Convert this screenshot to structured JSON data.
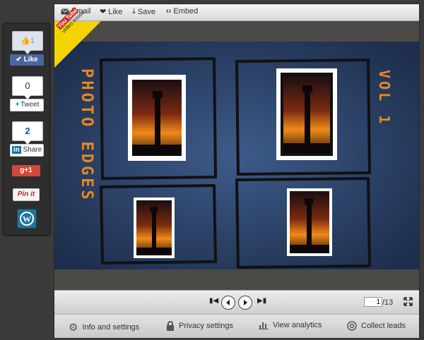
{
  "social": {
    "fb_count": "1",
    "fb_label": "Like",
    "tweet_count": "0",
    "tweet_label": "Tweet",
    "linkedin_count": "2",
    "linkedin_label": "Share",
    "gplus_label": "g+1",
    "pin_label": "Pin it"
  },
  "topbar": {
    "email_label": "Email",
    "like_label": "Like",
    "save_label": "Save",
    "embed_label": "Embed"
  },
  "badge": {
    "logo_text": "You Tube",
    "caption": "video inside."
  },
  "slide": {
    "title_left": "PHOTO EDGES",
    "title_right": "VOL 1"
  },
  "controls": {
    "page_value": "1",
    "page_total": "/13"
  },
  "bottombar": {
    "info_label": "Info and settings",
    "privacy_label": "Privacy settings",
    "analytics_label": "View analytics",
    "leads_label": "Collect leads"
  },
  "colors": {
    "accent_orange": "#e8891f",
    "slide_blue": "#3b5784",
    "yt_yellow": "#f3d400"
  }
}
